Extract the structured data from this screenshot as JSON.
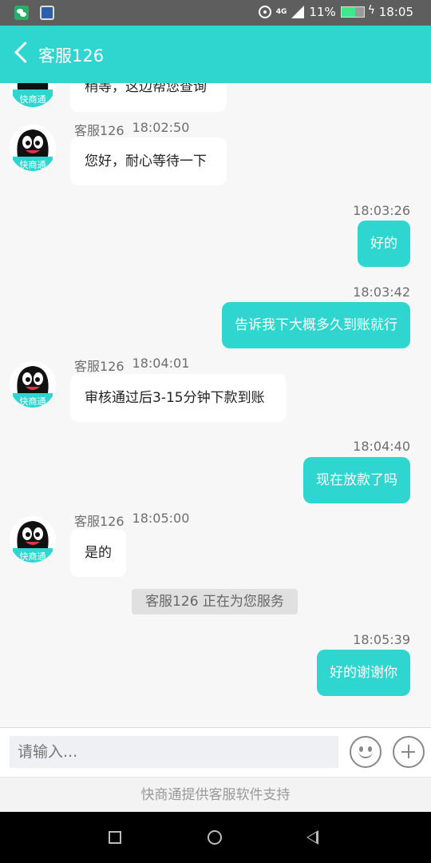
{
  "status_bar": {
    "battery": "11%",
    "time": "18:05",
    "network": "4G"
  },
  "header": {
    "title": "客服126"
  },
  "messages": {
    "m0": {
      "text": "稍等，这边帮您查询"
    },
    "m1": {
      "sender": "客服126",
      "time": "18:02:50",
      "text": "您好，耐心等待一下"
    },
    "m2": {
      "time": "18:03:26",
      "text": "好的"
    },
    "m3": {
      "time": "18:03:42",
      "text": "告诉我下大概多久到账就行"
    },
    "m4": {
      "sender": "客服126",
      "time": "18:04:01",
      "text": "审核通过后3-15分钟下款到账"
    },
    "m5": {
      "time": "18:04:40",
      "text": "现在放款了吗"
    },
    "m6": {
      "sender": "客服126",
      "time": "18:05:00",
      "text": "是的"
    },
    "m7": {
      "text": "客服126 正在为您服务"
    },
    "m8": {
      "time": "18:05:39",
      "text": "好的谢谢你"
    }
  },
  "input": {
    "placeholder": "请输入..."
  },
  "footer": {
    "text": "快商通提供客服软件支持"
  },
  "colors": {
    "accent": "#2fd6cf",
    "status_bar": "#5e5e5e"
  },
  "avatar": {
    "badge_text": "快商通"
  }
}
